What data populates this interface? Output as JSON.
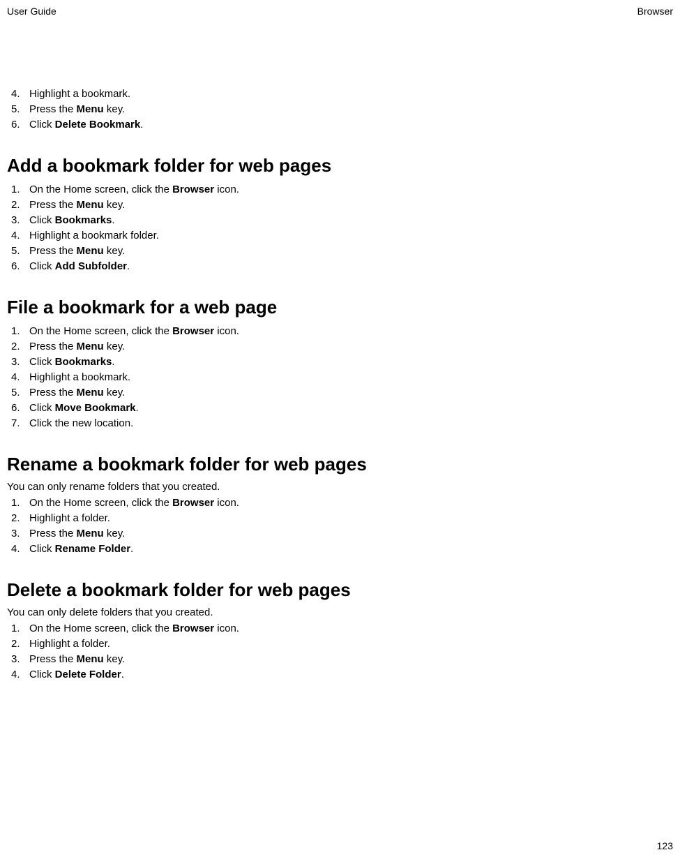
{
  "header": {
    "left": "User Guide",
    "right": "Browser"
  },
  "initialSteps": [
    {
      "num": "4.",
      "parts": [
        "Highlight a bookmark."
      ]
    },
    {
      "num": "5.",
      "parts": [
        "Press the ",
        {
          "b": "Menu"
        },
        " key."
      ]
    },
    {
      "num": "6.",
      "parts": [
        "Click ",
        {
          "b": "Delete Bookmark"
        },
        "."
      ]
    }
  ],
  "sections": [
    {
      "heading": "Add a bookmark folder for web pages",
      "intro": null,
      "steps": [
        {
          "num": "1.",
          "parts": [
            "On the Home screen, click the ",
            {
              "b": "Browser"
            },
            " icon."
          ]
        },
        {
          "num": "2.",
          "parts": [
            "Press the ",
            {
              "b": "Menu"
            },
            " key."
          ]
        },
        {
          "num": "3.",
          "parts": [
            "Click ",
            {
              "b": "Bookmarks"
            },
            "."
          ]
        },
        {
          "num": "4.",
          "parts": [
            "Highlight a bookmark folder."
          ]
        },
        {
          "num": "5.",
          "parts": [
            "Press the ",
            {
              "b": "Menu"
            },
            " key."
          ]
        },
        {
          "num": "6.",
          "parts": [
            "Click ",
            {
              "b": "Add Subfolder"
            },
            "."
          ]
        }
      ]
    },
    {
      "heading": "File a bookmark for a web page",
      "intro": null,
      "steps": [
        {
          "num": "1.",
          "parts": [
            "On the Home screen, click the ",
            {
              "b": "Browser"
            },
            " icon."
          ]
        },
        {
          "num": "2.",
          "parts": [
            "Press the ",
            {
              "b": "Menu"
            },
            " key."
          ]
        },
        {
          "num": "3.",
          "parts": [
            "Click ",
            {
              "b": "Bookmarks"
            },
            "."
          ]
        },
        {
          "num": "4.",
          "parts": [
            "Highlight a bookmark."
          ]
        },
        {
          "num": "5.",
          "parts": [
            "Press the ",
            {
              "b": "Menu"
            },
            " key."
          ]
        },
        {
          "num": "6.",
          "parts": [
            "Click ",
            {
              "b": "Move Bookmark"
            },
            "."
          ]
        },
        {
          "num": "7.",
          "parts": [
            "Click the new location."
          ]
        }
      ]
    },
    {
      "heading": "Rename a bookmark folder for web pages",
      "intro": "You can only rename folders that you created.",
      "steps": [
        {
          "num": "1.",
          "parts": [
            "On the Home screen, click the ",
            {
              "b": "Browser"
            },
            " icon."
          ]
        },
        {
          "num": "2.",
          "parts": [
            "Highlight a folder."
          ]
        },
        {
          "num": "3.",
          "parts": [
            "Press the ",
            {
              "b": "Menu"
            },
            " key."
          ]
        },
        {
          "num": "4.",
          "parts": [
            "Click ",
            {
              "b": "Rename Folder"
            },
            "."
          ]
        }
      ]
    },
    {
      "heading": "Delete a bookmark folder for web pages",
      "intro": "You can only delete folders that you created.",
      "steps": [
        {
          "num": "1.",
          "parts": [
            "On the Home screen, click the ",
            {
              "b": "Browser"
            },
            " icon."
          ]
        },
        {
          "num": "2.",
          "parts": [
            "Highlight a folder."
          ]
        },
        {
          "num": "3.",
          "parts": [
            "Press the ",
            {
              "b": "Menu"
            },
            " key."
          ]
        },
        {
          "num": "4.",
          "parts": [
            "Click ",
            {
              "b": "Delete Folder"
            },
            "."
          ]
        }
      ]
    }
  ],
  "footer": {
    "pageNumber": "123"
  }
}
